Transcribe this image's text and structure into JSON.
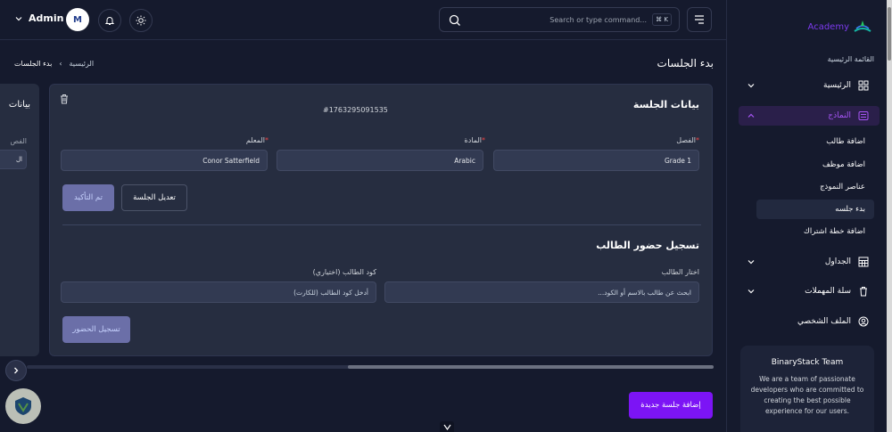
{
  "app": {
    "logo_text": "Academy"
  },
  "sidebar": {
    "menu_title": "القائمة الرئيسية",
    "items": [
      {
        "label": "الرئيسية"
      },
      {
        "label": "النماذج"
      },
      {
        "label": "الجداول"
      },
      {
        "label": "سلة المهملات"
      },
      {
        "label": "الملف الشخصي"
      }
    ],
    "sub_items": [
      {
        "label": "اضافة طالب"
      },
      {
        "label": "اضافة موظف"
      },
      {
        "label": "عناصر النموذج"
      },
      {
        "label": "بدء جلسه"
      },
      {
        "label": "اضافة خطة اشتراك"
      }
    ],
    "team": {
      "title": "BinaryStack Team",
      "description": "We are a team of passionate developers who are committed to creating the best possible experience for our users."
    }
  },
  "topbar": {
    "user": "Admin",
    "avatar_text": "M",
    "search_placeholder": "Search or type command...",
    "shortcut": "⌘ K"
  },
  "page": {
    "title": "بدء الجلسات",
    "breadcrumb": [
      "الرئيسية",
      "بدء الجلسات"
    ]
  },
  "session_card": {
    "title": "بيانات الجلسة",
    "id": "#1763295091535",
    "fields": [
      {
        "label": "الفصل",
        "value": "Grade 1"
      },
      {
        "label": "المادة",
        "value": "Arabic"
      },
      {
        "label": "المعلم",
        "value": "Conor Satterfield"
      }
    ],
    "edit_label": "تعديل الجلسة",
    "confirm_label": "تم التأكيد",
    "attendance_title": "تسجيل حضور الطالب",
    "student_select_label": "اختار الطالب",
    "student_select_placeholder": "ابحث عن طالب بالاسم أو الكود...",
    "student_code_label": "كود الطالب (اختياري)",
    "student_code_placeholder": "أدخل كود الطالب (للكارت)",
    "attend_label": "تسجيل الحضور"
  },
  "left_card": {
    "title": "بيانات",
    "label": "الفص",
    "value": "ال"
  },
  "add_session_label": "إضافة جلسة جديدة",
  "colors": {
    "accent": "#7c14f5",
    "active_nav": "#a855f7",
    "background": "#151a2d",
    "card": "#262d40"
  }
}
